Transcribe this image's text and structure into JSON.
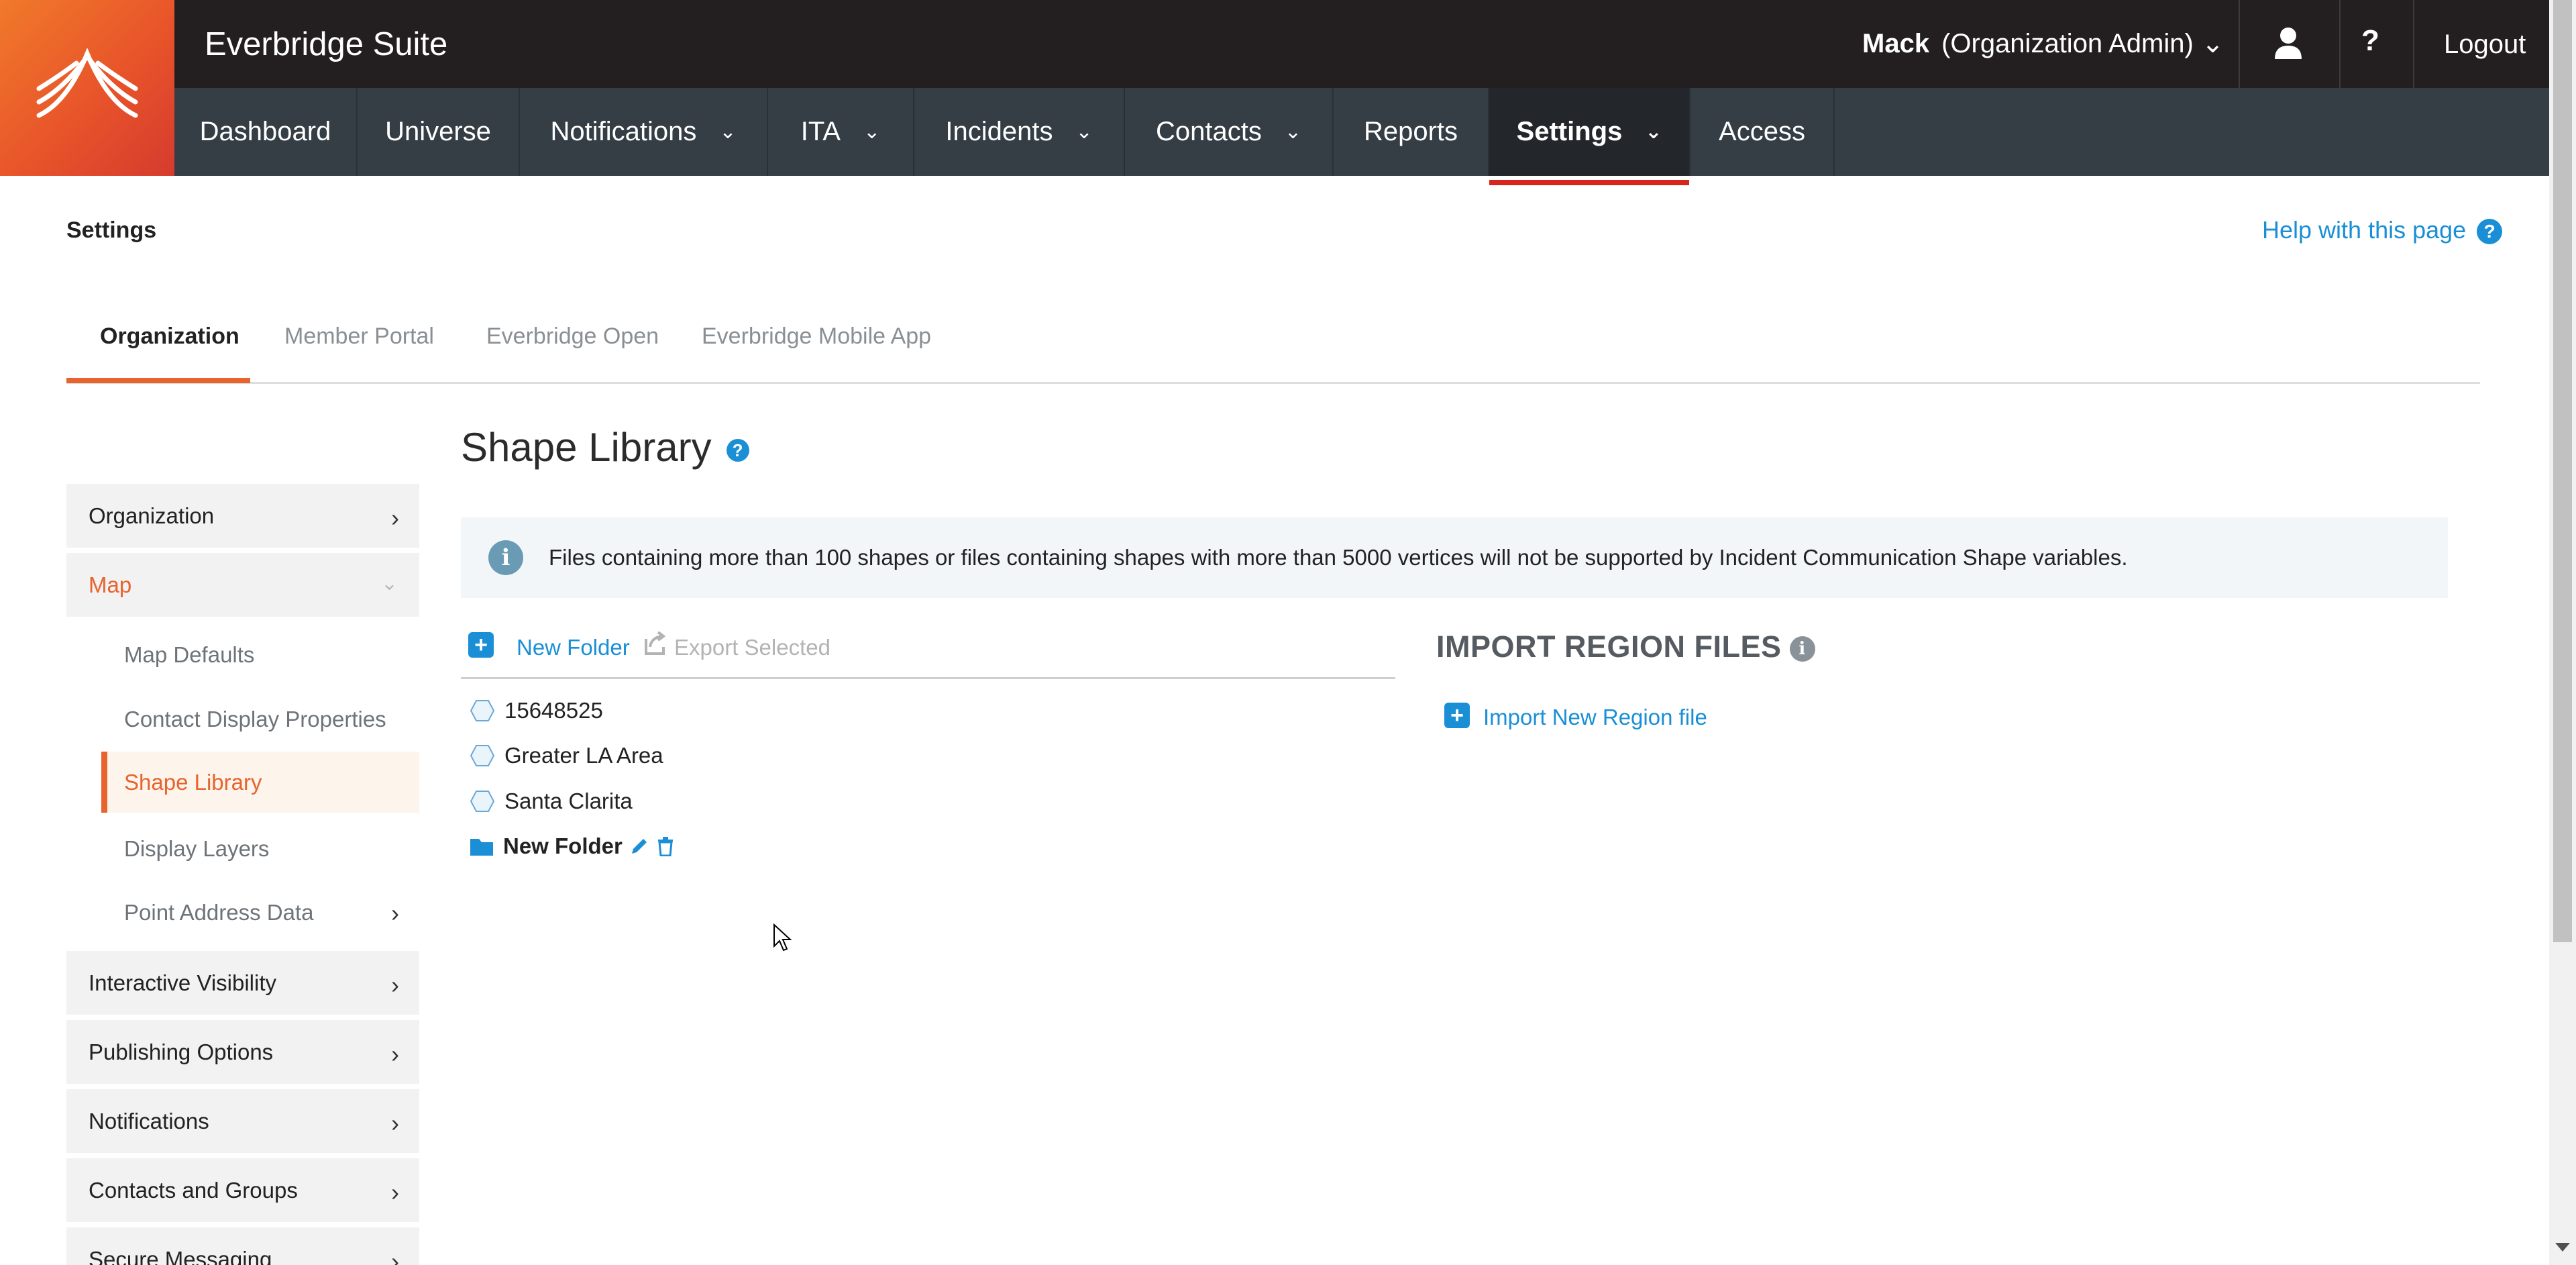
{
  "app": {
    "title": "Everbridge Suite"
  },
  "user": {
    "name": "Mack",
    "role": "(Organization Admin)",
    "help_label": "?",
    "logout_label": "Logout"
  },
  "nav": {
    "items": [
      {
        "label": "Dashboard",
        "dropdown": false
      },
      {
        "label": "Universe",
        "dropdown": false
      },
      {
        "label": "Notifications",
        "dropdown": true
      },
      {
        "label": "ITA",
        "dropdown": true
      },
      {
        "label": "Incidents",
        "dropdown": true
      },
      {
        "label": "Contacts",
        "dropdown": true
      },
      {
        "label": "Reports",
        "dropdown": false
      },
      {
        "label": "Settings",
        "dropdown": true,
        "active": true
      },
      {
        "label": "Access",
        "dropdown": false
      }
    ]
  },
  "page": {
    "label": "Settings",
    "help_link": "Help with this page"
  },
  "tabs": [
    {
      "label": "Organization",
      "active": true
    },
    {
      "label": "Member Portal"
    },
    {
      "label": "Everbridge Open"
    },
    {
      "label": "Everbridge Mobile App"
    }
  ],
  "sidebar": {
    "items": [
      {
        "label": "Organization"
      },
      {
        "label": "Map",
        "open": true
      },
      {
        "label": "Interactive Visibility"
      },
      {
        "label": "Publishing Options"
      },
      {
        "label": "Notifications"
      },
      {
        "label": "Contacts and Groups"
      },
      {
        "label": "Secure Messaging"
      }
    ],
    "map_children": [
      {
        "label": "Map Defaults"
      },
      {
        "label": "Contact Display Properties"
      },
      {
        "label": "Shape Library",
        "active": true
      },
      {
        "label": "Display Layers"
      },
      {
        "label": "Point Address Data",
        "has_children": true
      }
    ]
  },
  "main": {
    "title": "Shape Library",
    "info_banner": "Files containing more than 100 shapes or files containing shapes with more than 5000 vertices will not be supported by Incident Communication Shape variables.",
    "toolbar": {
      "new_folder": "New Folder",
      "export_selected": "Export Selected"
    },
    "tree": [
      {
        "label": "15648525",
        "type": "shape"
      },
      {
        "label": "Greater LA Area",
        "type": "shape"
      },
      {
        "label": "Santa Clarita",
        "type": "shape"
      },
      {
        "label": "New Folder",
        "type": "folder"
      }
    ],
    "import": {
      "title": "IMPORT REGION FILES",
      "link": "Import New Region file"
    }
  },
  "colors": {
    "accent": "#e8632d",
    "link": "#1a8fd6",
    "topbar": "#231f20",
    "navbar": "#353e45",
    "active_underline": "#d9261c"
  }
}
